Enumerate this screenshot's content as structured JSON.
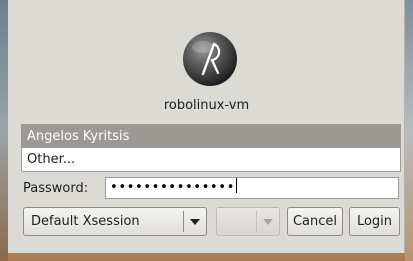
{
  "greeter": {
    "hostname": "robolinux-vm",
    "users": [
      {
        "label": "Angelos Kyritsis",
        "selected": true
      },
      {
        "label": "Other...",
        "selected": false
      }
    ],
    "password_label": "Password:",
    "password_mask": "•••••••••••••••",
    "session": "Default Xsession",
    "language": "",
    "cancel_label": "Cancel",
    "login_label": "Login"
  },
  "colors": {
    "panel": "#dcdad5",
    "selected_row": "#9c9893"
  },
  "icons": {
    "logo": "robolinux-logo-icon",
    "dropdown": "chevron-down-icon"
  }
}
